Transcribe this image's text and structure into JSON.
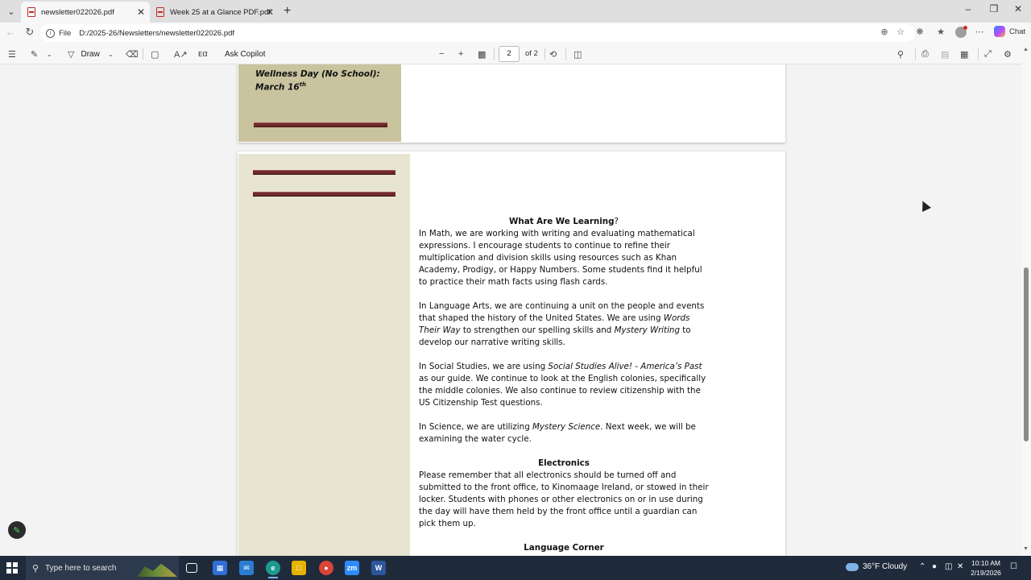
{
  "browser": {
    "tabs": [
      {
        "title": "newsletter022026.pdf",
        "active": true
      },
      {
        "title": "Week 25 at a Glance PDF.pdf",
        "active": false
      }
    ],
    "address": {
      "scheme": "File",
      "path": "D:/2025-26/Newsletters/newsletter022026.pdf"
    },
    "copilot_label": "Chat"
  },
  "pdf_toolbar": {
    "draw_label": "Draw",
    "ask_copilot_label": "Ask Copilot",
    "current_page": "2",
    "page_of": "of 2"
  },
  "page1": {
    "event_line1": "Wellness Day (No School):",
    "event_line2": "March 16",
    "event_sup": "th"
  },
  "page2": {
    "learning_heading_bold": "What Are We Learning",
    "learning_heading_rest": "?",
    "math": "In Math, we are working with writing and evaluating mathematical expressions. I encourage students to continue to refine their multiplication and division skills using resources such as Khan Academy, Prodigy, or Happy Numbers. Some students find it helpful to practice their math facts using flash cards.",
    "la_1": "In Language Arts, we are continuing a unit on the people and events that shaped the history of the United States. We are using ",
    "la_italic1": "Words Their Way",
    "la_2": " to strengthen our spelling skills and ",
    "la_italic2": "Mystery Writing",
    "la_3": " to develop our narrative writing skills.",
    "ss_1": "In Social Studies, we are using ",
    "ss_italic": "Social Studies Alive! - America’s Past",
    "ss_2": " as our guide. We continue to look at the English colonies, specifically the middle colonies. We also continue to review citizenship with the US Citizenship Test questions.",
    "sci_1": "In Science, we are utilizing ",
    "sci_italic": "Mystery Science",
    "sci_2": ". Next week, we will be examining the water cycle.",
    "electronics_heading": "Electronics",
    "electronics": "Please remember that all electronics should be turned off and submitted to the front office, to Kinomaage Ireland, or stowed in their locker. Students with phones or other electronics on or in use during the day will have them held by the front office until a guardian can pick them up.",
    "language_corner_heading": "Language Corner"
  },
  "taskbar": {
    "search_placeholder": "Type here to search",
    "weather": "36°F  Cloudy",
    "time": "10:10 AM",
    "date": "2/19/2026",
    "apps": [
      "task-view",
      "store",
      "mail",
      "edge",
      "file-explorer",
      "chrome",
      "zoom",
      "word"
    ]
  },
  "colors": {
    "sidebar_tan": "#c9c39e",
    "sidebar_cream": "#e8e4d2",
    "rule_maroon": "#6e2a2a",
    "pdf_red": "#c62828"
  }
}
